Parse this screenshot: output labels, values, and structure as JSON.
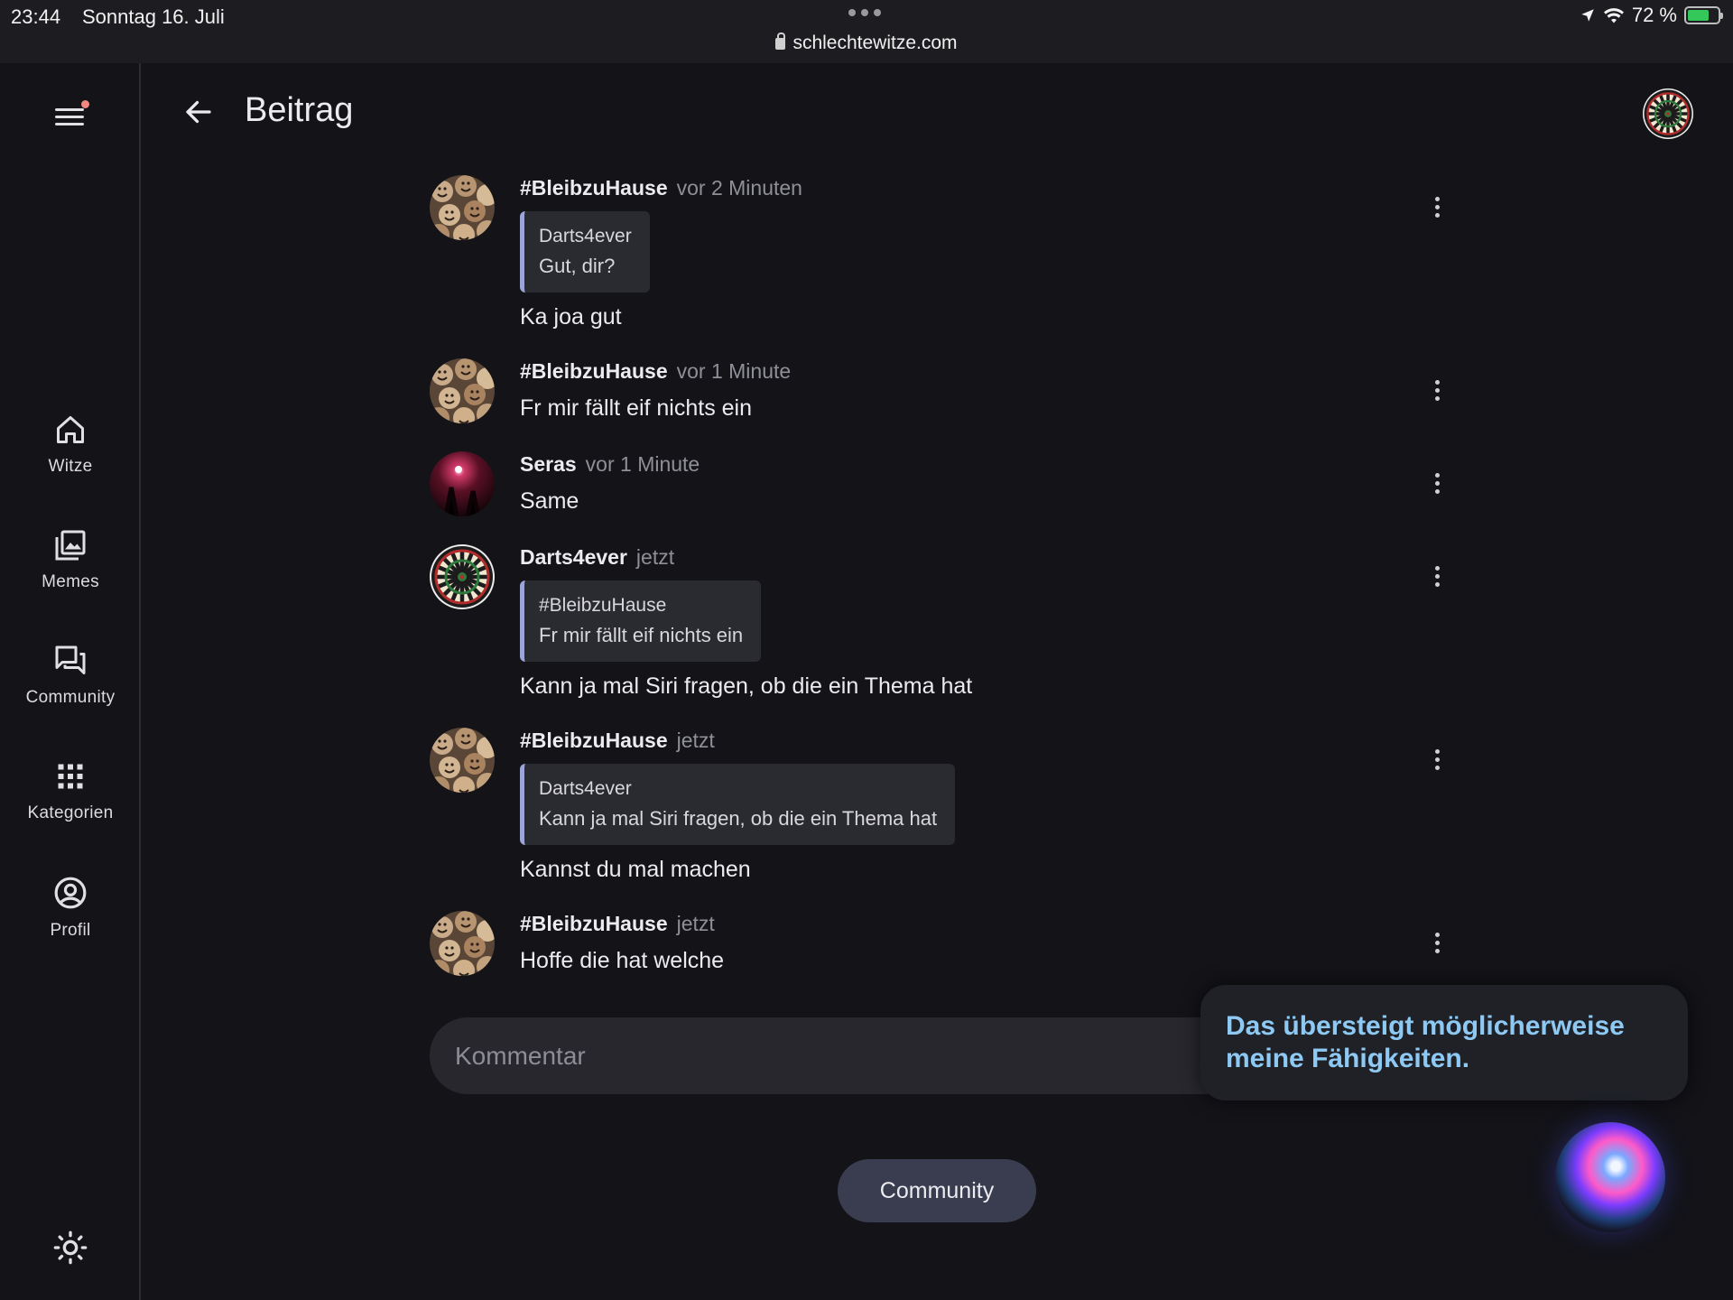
{
  "status_bar": {
    "time": "23:44",
    "date": "Sonntag 16. Juli",
    "url": "schlechtewitze.com",
    "battery": "72 %",
    "battery_level": 0.72
  },
  "sidebar": {
    "items": [
      {
        "label": "Witze",
        "icon": "home-icon"
      },
      {
        "label": "Memes",
        "icon": "image-gallery-icon"
      },
      {
        "label": "Community",
        "icon": "forum-icon"
      },
      {
        "label": "Kategorien",
        "icon": "apps-grid-icon"
      },
      {
        "label": "Profil",
        "icon": "account-circle-icon"
      }
    ],
    "theme_icon": "sun-icon",
    "menu_icon": "hamburger-menu-icon"
  },
  "header": {
    "title": "Beitrag",
    "back_icon": "arrow-left-icon"
  },
  "comments": [
    {
      "author": "#BleibzuHause",
      "time": "vor 2 Minuten",
      "quote": {
        "author": "Darts4ever",
        "text": "Gut, dir?"
      },
      "text": "Ka joa gut"
    },
    {
      "author": "#BleibzuHause",
      "time": "vor 1 Minute",
      "text": "Fr mir fällt eif nichts ein"
    },
    {
      "author": "Seras",
      "time": "vor 1 Minute",
      "text": "Same"
    },
    {
      "author": "Darts4ever",
      "time": "jetzt",
      "quote": {
        "author": "#BleibzuHause",
        "text": "Fr mir fällt eif nichts ein"
      },
      "text": "Kann ja mal Siri fragen, ob die ein Thema hat"
    },
    {
      "author": "#BleibzuHause",
      "time": "jetzt",
      "quote": {
        "author": "Darts4ever",
        "text": "Kann ja mal Siri fragen, ob die ein Thema hat"
      },
      "text": "Kannst du mal machen"
    },
    {
      "author": "#BleibzuHause",
      "time": "jetzt",
      "text": "Hoffe die hat welche"
    }
  ],
  "comment_input": {
    "placeholder": "Kommentar"
  },
  "siri": {
    "message": "Das übersteigt möglicherweise meine Fähigkeiten."
  },
  "community_button": {
    "label": "Community"
  },
  "colors": {
    "background": "#131318",
    "quote_accent": "#9ba6d6",
    "siri_text": "#8ec9f3",
    "notification_dot": "#f08a80"
  }
}
